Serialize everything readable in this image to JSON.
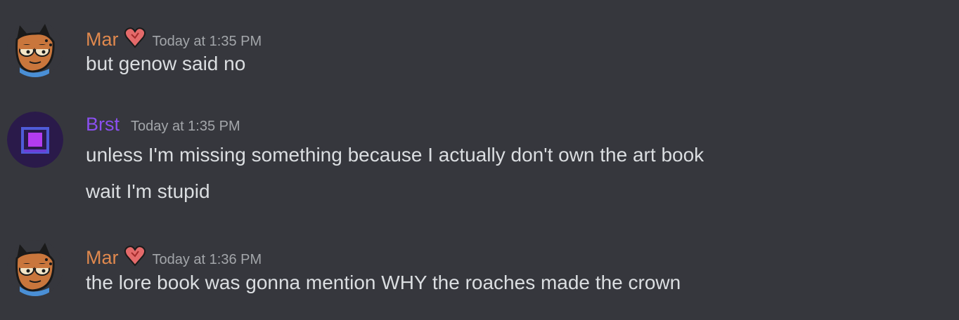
{
  "messages": [
    {
      "author": "Mar",
      "author_color": "#e0894e",
      "avatar_icon": "cockroach-cat-avatar-icon",
      "role_icon": "heart-icon",
      "timestamp": "Today at 1:35 PM",
      "lines": [
        "but genow said no"
      ]
    },
    {
      "author": "Brst",
      "author_color": "#8a4ff0",
      "avatar_icon": "purple-square-avatar-icon",
      "timestamp": "Today at 1:35 PM",
      "lines": [
        "unless I'm missing something because I actually don't own the art book",
        "wait I'm stupid"
      ]
    },
    {
      "author": "Mar",
      "author_color": "#e0894e",
      "avatar_icon": "cockroach-cat-avatar-icon",
      "role_icon": "heart-icon",
      "timestamp": "Today at 1:36 PM",
      "lines": [
        "the lore book was gonna mention WHY the roaches made the crown"
      ]
    }
  ],
  "colors": {
    "background": "#36373d",
    "text": "#dbdee1",
    "timestamp": "#a3a6aa"
  }
}
